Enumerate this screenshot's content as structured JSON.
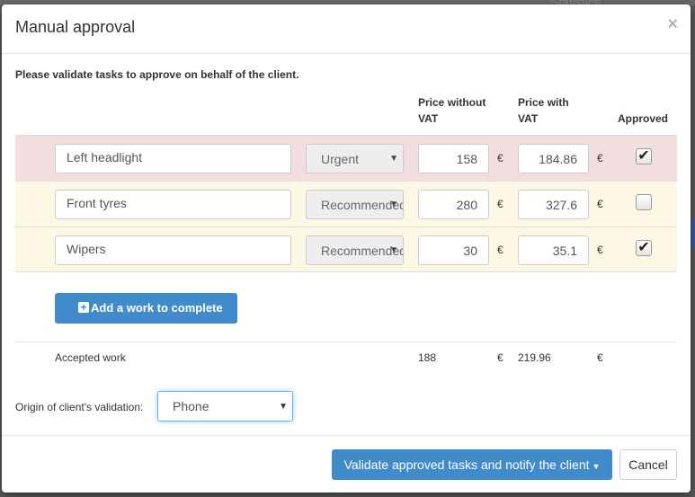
{
  "background": {
    "app_hint": "Statistics"
  },
  "modal": {
    "title": "Manual approval",
    "close_label": "×",
    "instructions": "Please validate tasks to approve on behalf of the client.",
    "columns": {
      "price_without_vat_line1": "Price without",
      "price_without_vat_line2": "VAT",
      "price_with_vat_line1": "Price with",
      "price_with_vat_line2": "VAT",
      "approved": "Approved"
    },
    "currency": "€",
    "tasks": [
      {
        "name": "Left headlight",
        "priority": "Urgent",
        "price_without_vat": "158",
        "price_with_vat": "184.86",
        "approved": true,
        "row_color": "#f2dede"
      },
      {
        "name": "Front tyres",
        "priority": "Recommended",
        "price_without_vat": "280",
        "price_with_vat": "327.6",
        "approved": false,
        "row_color": "#fcf8e3"
      },
      {
        "name": "Wipers",
        "priority": "Recommended",
        "price_without_vat": "30",
        "price_with_vat": "35.1",
        "approved": true,
        "row_color": "#fcf8e3"
      }
    ],
    "add_work_label": "Add a work to complete",
    "totals": {
      "label": "Accepted work",
      "price_without_vat": "188",
      "price_with_vat": "219.96"
    },
    "origin": {
      "label": "Origin of client's validation:",
      "selected": "Phone"
    },
    "footer": {
      "validate_label": "Validate approved tasks and notify the client",
      "cancel_label": "Cancel"
    },
    "colors": {
      "primary": "#428bca",
      "urgent_row": "#f2dede",
      "recommended_row": "#fcf8e3"
    }
  }
}
